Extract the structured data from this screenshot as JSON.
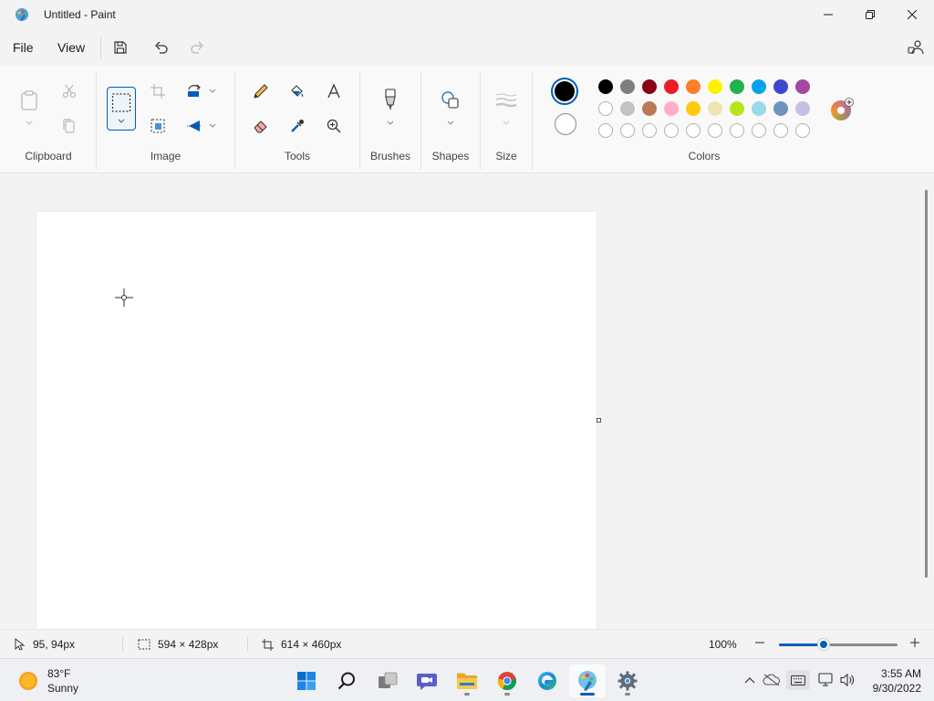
{
  "window": {
    "title": "Untitled - Paint"
  },
  "menu": {
    "file": "File",
    "view": "View"
  },
  "ribbon": {
    "clipboard_label": "Clipboard",
    "image_label": "Image",
    "tools_label": "Tools",
    "brushes_label": "Brushes",
    "shapes_label": "Shapes",
    "size_label": "Size",
    "colors_label": "Colors"
  },
  "colors": {
    "primary": "#000000",
    "secondary": "#ffffff",
    "palette_row1": [
      "#000000",
      "#7f7f7f",
      "#880015",
      "#ed1c24",
      "#ff7f27",
      "#fff200",
      "#22b14c",
      "#00a2e8",
      "#3f48cc",
      "#a349a4"
    ],
    "palette_row2": [
      "#ffffff",
      "#c3c3c3",
      "#b97a57",
      "#ffaec9",
      "#ffc90e",
      "#efe4b0",
      "#b5e61d",
      "#99d9ea",
      "#7092be",
      "#c8bfe7"
    ],
    "palette_row3_empty_count": 10,
    "accent": "#005fb8"
  },
  "status": {
    "cursor_position": "95, 94px",
    "selection_size": "594 × 428px",
    "canvas_size": "614 × 460px",
    "zoom": "100%",
    "zoom_fraction": 0.38
  },
  "taskbar": {
    "weather_temp": "83°F",
    "weather_desc": "Sunny",
    "time": "3:55 AM",
    "date": "9/30/2022",
    "apps": [
      "start-icon",
      "search-icon",
      "task-view-icon",
      "teams-chat-icon",
      "file-explorer-icon",
      "chrome-icon",
      "edge-icon",
      "paint-icon",
      "settings-icon"
    ]
  }
}
